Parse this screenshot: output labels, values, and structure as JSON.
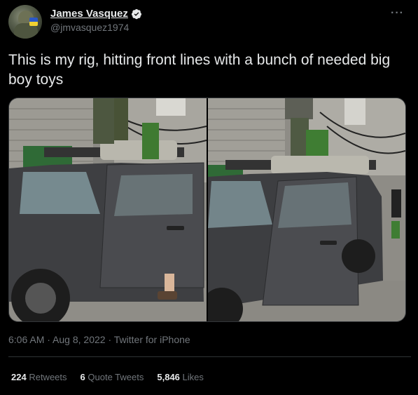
{
  "author": {
    "name": "James Vasquez",
    "handle": "@jmvasquez1974",
    "verified": true
  },
  "tweet": {
    "text": "This is my rig, hitting front lines with a bunch of needed big boy toys"
  },
  "media": {
    "images": [
      {
        "alt": ""
      },
      {
        "alt": ""
      }
    ]
  },
  "meta": {
    "time": "6:06 AM",
    "date": "Aug 8, 2022",
    "source": "Twitter for iPhone"
  },
  "stats": {
    "retweets_count": "224",
    "retweets_label": "Retweets",
    "quotes_count": "6",
    "quotes_label": "Quote Tweets",
    "likes_count": "5,846",
    "likes_label": "Likes"
  },
  "icons": {
    "more": "more-icon",
    "verified": "verified-badge-icon"
  },
  "colors": {
    "background": "#000000",
    "text": "#e7e9ea",
    "secondary": "#71767b",
    "divider": "#2f3336"
  }
}
